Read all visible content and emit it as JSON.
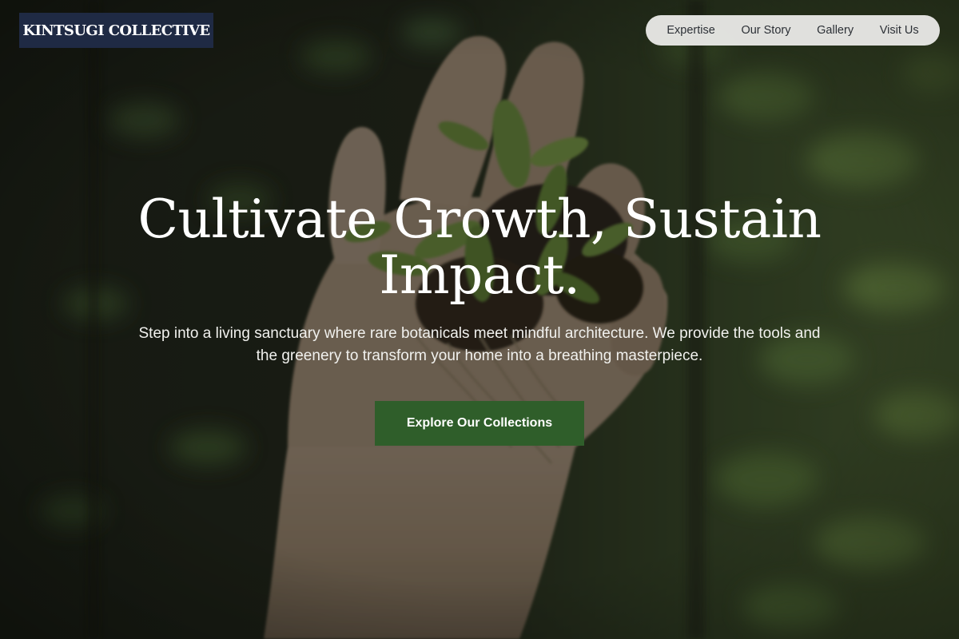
{
  "brand": {
    "name": "KINTSUGI COLLECTIVE",
    "logo_bg": "#1f2a44"
  },
  "nav": {
    "items": [
      {
        "label": "Expertise"
      },
      {
        "label": "Our Story"
      },
      {
        "label": "Gallery"
      },
      {
        "label": "Visit Us"
      }
    ]
  },
  "hero": {
    "title": "Cultivate Growth, Sustain Impact.",
    "subtitle": "Step into a living sanctuary where rare botanicals meet mindful architecture. We provide the tools and the greenery to transform your home into a breathing masterpiece.",
    "cta_label": "Explore Our Collections",
    "cta_color": "#2f5e2a",
    "background_image": "hand holding seedlings over seedling trays"
  }
}
